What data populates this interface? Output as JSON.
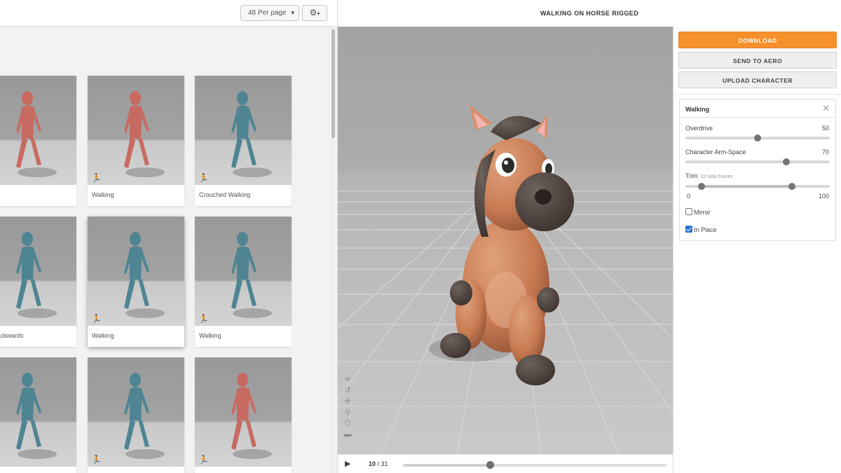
{
  "toolbar": {
    "per_page": "48 Per page",
    "gear_icon": "gear-icon"
  },
  "header": {
    "title": "WALKING ON HORSE RIGGED"
  },
  "animations": [
    {
      "label": "ng",
      "color": "#c76b62"
    },
    {
      "label": "Walking",
      "color": "#c76b62"
    },
    {
      "label": "Crouched Walking",
      "color": "#4f8593"
    },
    {
      "label": "ng Backwards",
      "color": "#4f8593"
    },
    {
      "label": "Walking",
      "color": "#4f8593",
      "selected": true
    },
    {
      "label": "Walking",
      "color": "#4f8593"
    },
    {
      "label": "",
      "color": "#4f8593"
    },
    {
      "label": "",
      "color": "#4f8593"
    },
    {
      "label": "",
      "color": "#c76b62"
    }
  ],
  "playback": {
    "current_frame": "10",
    "separator": " / ",
    "total_frames": "31",
    "progress": 0.33
  },
  "actions": {
    "download": "DOWNLOAD",
    "send_to_aero": "SEND TO AERO",
    "upload_character": "UPLOAD CHARACTER"
  },
  "settings": {
    "title": "Walking",
    "overdrive": {
      "label": "Overdrive",
      "value": "50",
      "level": 0.5
    },
    "arm_space": {
      "label": "Character Arm-Space",
      "value": "70",
      "level": 0.7
    },
    "trim": {
      "label": "Trim",
      "sub": "32 total frames",
      "min": "0",
      "max": "100",
      "start": 0.11,
      "end": 0.74
    },
    "mirror": {
      "label": "Mirror",
      "checked": false
    },
    "in_place": {
      "label": "In Place",
      "checked": true
    }
  },
  "colors": {
    "accent": "#f5902b",
    "horse_body": "#c77a52",
    "horse_dark": "#4a3f3a"
  }
}
